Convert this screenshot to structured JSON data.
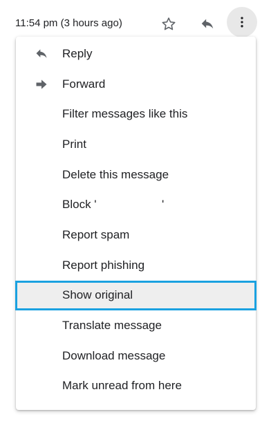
{
  "header": {
    "timestamp": "11:54 pm (3 hours ago)",
    "star_icon": "star-outline-icon",
    "reply_icon": "reply-arrow-icon",
    "more_icon": "vertical-dots-icon"
  },
  "menu": {
    "items": [
      {
        "label": "Reply",
        "icon": "reply-arrow-icon"
      },
      {
        "label": "Forward",
        "icon": "forward-arrow-icon"
      },
      {
        "label": "Filter messages like this"
      },
      {
        "label": "Print"
      },
      {
        "label": "Delete this message"
      },
      {
        "label": "Block '                    '"
      },
      {
        "label": "Report spam"
      },
      {
        "label": "Report phishing"
      },
      {
        "label": "Show original",
        "highlighted": true
      },
      {
        "label": "Translate message"
      },
      {
        "label": "Download message"
      },
      {
        "label": "Mark unread from here"
      }
    ]
  },
  "colors": {
    "highlight_border": "#1aa1e0",
    "highlight_bg": "#eeeeee",
    "icon_color": "#5f6368",
    "text_color": "#202124"
  }
}
